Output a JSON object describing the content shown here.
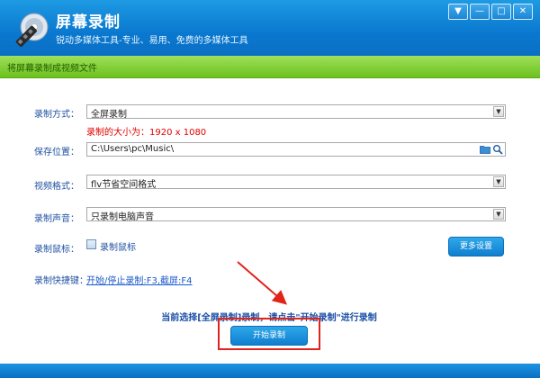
{
  "window": {
    "title": "屏幕录制",
    "subtitle": "锐动多媒体工具-专业、易用、免费的多媒体工具",
    "controls": [
      "▼",
      "—",
      "□",
      "✕"
    ]
  },
  "section_header": "将屏幕录制成视频文件",
  "form": {
    "record_mode": {
      "label": "录制方式：",
      "value": "全屏录制"
    },
    "size_note": "录制的大小为：1920 x 1080",
    "save_path": {
      "label": "保存位置：",
      "value": "C:\\Users\\pc\\Music\\"
    },
    "video_format": {
      "label": "视频格式：",
      "value": "flv节省空间格式"
    },
    "audio": {
      "label": "录制声音：",
      "value": "只录制电脑声音"
    },
    "mouse": {
      "label": "录制鼠标：",
      "checkbox_label": "录制鼠标",
      "checked": false
    },
    "more_settings": "更多设置",
    "hotkeys": {
      "label": "录制快捷键：",
      "value": "开始/停止录制:F3,截屏:F4"
    }
  },
  "status_message": "当前选择[全屏录制]录制，请点击\"开始录制\"进行录制",
  "start_button": "开始录制",
  "colors": {
    "title_blue": "#0a78cf",
    "header_green": "#6cc11e",
    "label_blue": "#2152a3",
    "note_red": "#e00000",
    "annotation_red": "#e0241a"
  }
}
